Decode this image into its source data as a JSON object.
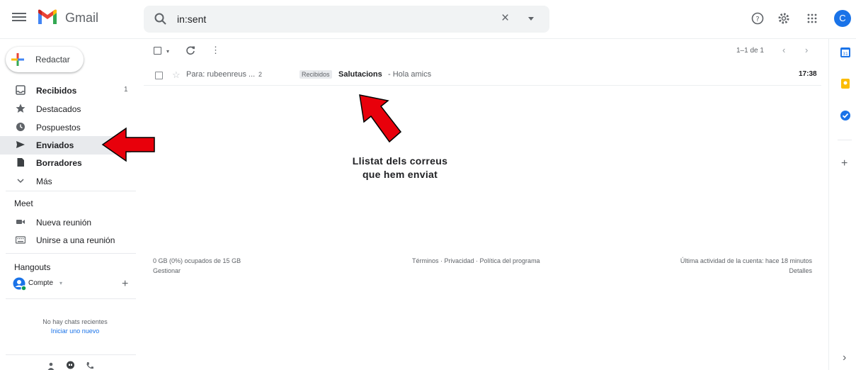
{
  "app": {
    "name": "Gmail",
    "colors": {
      "accent": "#1a73e8",
      "arrow": "#e8000b"
    }
  },
  "search": {
    "query": "in:sent",
    "clear": "×"
  },
  "account": {
    "initial": "C"
  },
  "compose": {
    "label": "Redactar"
  },
  "nav": [
    {
      "label": "Recibidos",
      "count": "1",
      "icon": "inbox-icon"
    },
    {
      "label": "Destacados",
      "count": "",
      "icon": "star-icon"
    },
    {
      "label": "Pospuestos",
      "count": "",
      "icon": "clock-icon"
    },
    {
      "label": "Enviados",
      "count": "",
      "icon": "send-icon"
    },
    {
      "label": "Borradores",
      "count": "",
      "icon": "draft-icon"
    },
    {
      "label": "Más",
      "count": "",
      "icon": "chevron-down-icon"
    }
  ],
  "meet": {
    "title": "Meet",
    "new_meeting": "Nueva reunión",
    "join": "Unirse a una reunión"
  },
  "hangouts": {
    "title": "Hangouts",
    "account": "Compte",
    "no_chats": "No hay chats recientes",
    "start_new": "Iniciar uno nuevo"
  },
  "list": {
    "pager": "1–1 de 1",
    "rows": [
      {
        "from": "Para: rubeenreus ...",
        "count": "2",
        "label": "Recibidos",
        "subject": "Salutacions",
        "snippet": "- Hola amics",
        "time": "17:38"
      }
    ]
  },
  "footer": {
    "storage": "0 GB (0%) ocupados de 15 GB",
    "manage": "Gestionar",
    "links": "Términos · Privacidad · Política del programa",
    "activity": "Última actividad de la cuenta: hace 18 minutos",
    "details": "Detalles"
  },
  "annotation": {
    "line1": "Llistat dels correus",
    "line2": "que hem enviat"
  }
}
